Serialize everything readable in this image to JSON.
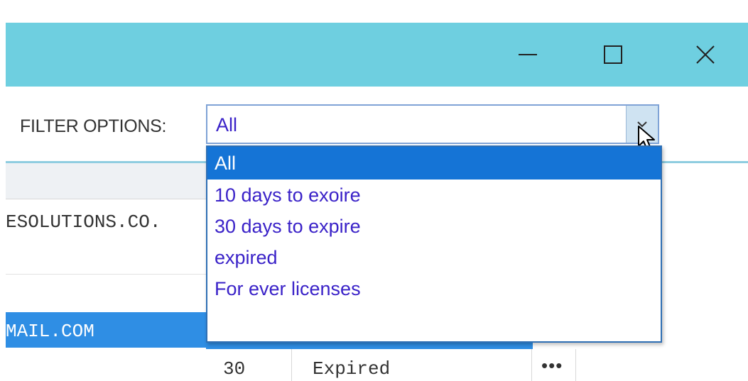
{
  "window": {
    "minimize_icon": "minimize-icon",
    "maximize_icon": "maximize-icon",
    "close_icon": "close-icon",
    "titlebar_color": "#6ecfe0"
  },
  "filter": {
    "label": "FILTER OPTIONS:",
    "selected_value": "All",
    "options": [
      "All",
      "10 days to exoire",
      "30 days to expire",
      "expired",
      "For ever licenses"
    ],
    "selected_index": 0,
    "highlight_color": "#1574d6",
    "text_color": "#3a22c8"
  },
  "grid": {
    "rows": [
      {
        "domain": "ESOLUTIONS.CO."
      },
      {
        "email": "MAIL.COM"
      },
      {
        "days": "30",
        "status": "Expired",
        "more": "•••"
      }
    ],
    "selected_row_color": "#2f8ee4"
  }
}
